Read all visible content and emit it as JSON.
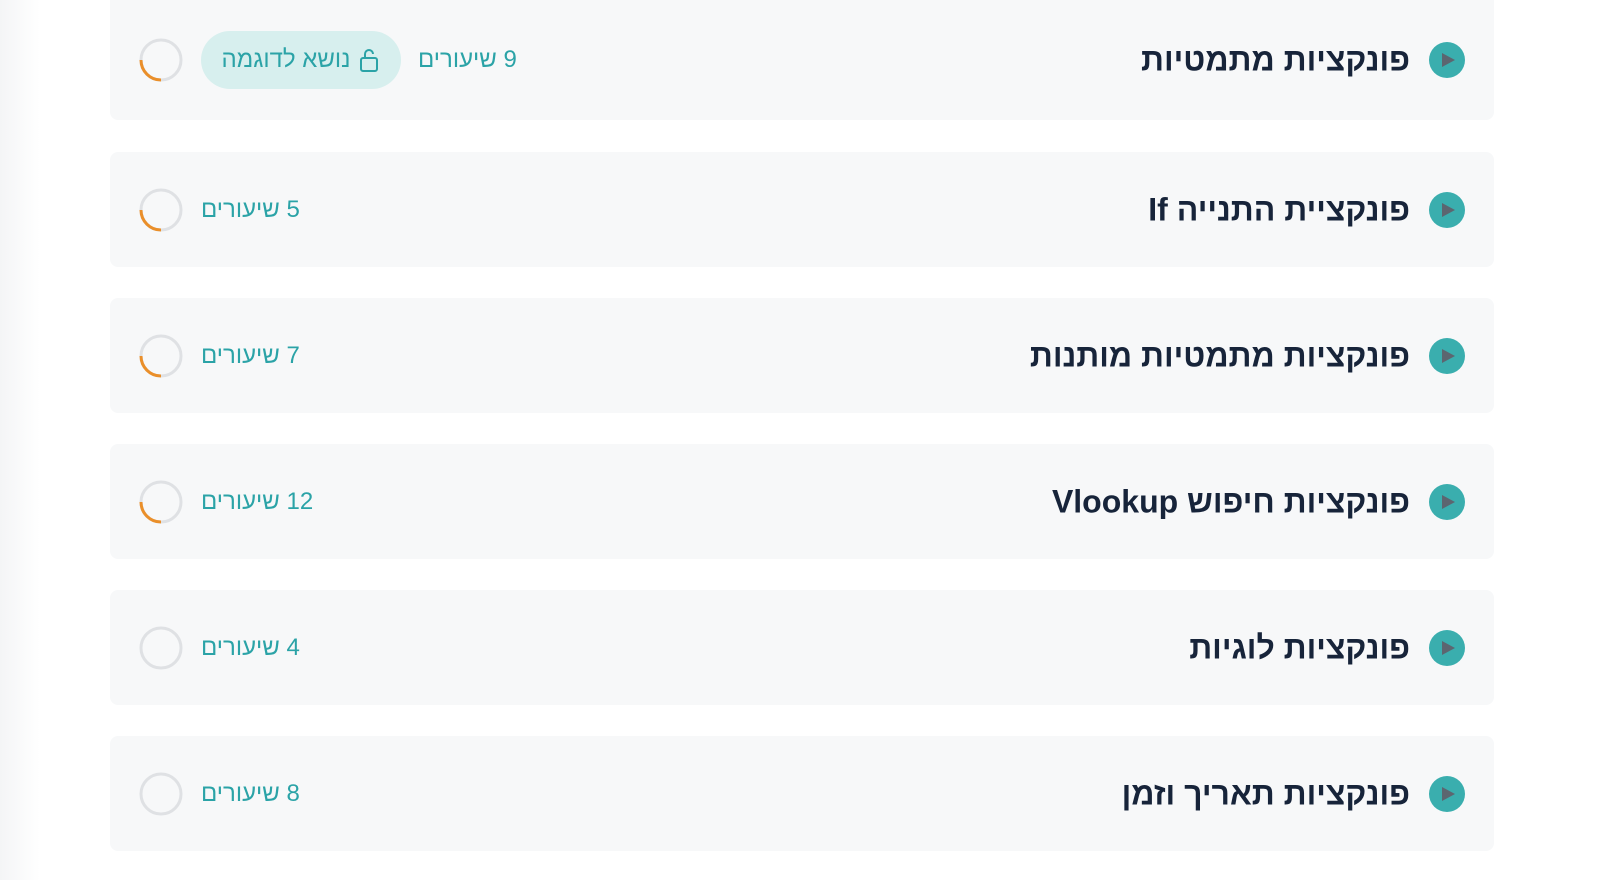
{
  "colors": {
    "accent": "#3aaeae",
    "title": "#17243a",
    "count": "#2ba3a7",
    "row_bg": "#f7f8f9",
    "badge_bg": "#d7efee",
    "progress": "#ea8f2a",
    "ring_track": "#dfe1e4"
  },
  "badge": {
    "label": "נושא לדוגמה",
    "icon": "unlocked-lock-icon"
  },
  "topics": [
    {
      "title": "פונקציות מתמטיות",
      "lessons": "9 שיעורים",
      "has_badge": true,
      "progress": 0.25
    },
    {
      "title": "פונקציית התנייה If",
      "lessons": "5 שיעורים",
      "has_badge": false,
      "progress": 0.25
    },
    {
      "title": "פונקציות מתמטיות מותנות",
      "lessons": "7 שיעורים",
      "has_badge": false,
      "progress": 0.25
    },
    {
      "title": "פונקציות חיפוש Vlookup",
      "lessons": "12 שיעורים",
      "has_badge": false,
      "progress": 0.25
    },
    {
      "title": "פונקציות לוגיות",
      "lessons": "4 שיעורים",
      "has_badge": false,
      "progress": 0
    },
    {
      "title": "פונקציות תאריך וזמן",
      "lessons": "8 שיעורים",
      "has_badge": false,
      "progress": 0
    }
  ]
}
